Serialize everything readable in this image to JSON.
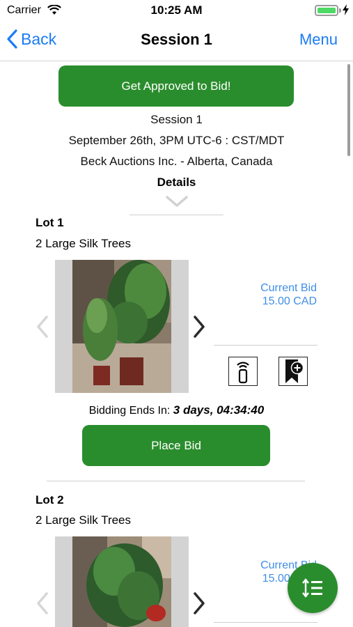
{
  "status_bar": {
    "carrier": "Carrier",
    "time": "10:25 AM",
    "battery_color": "#4cd964"
  },
  "nav": {
    "back_label": "Back",
    "title": "Session 1",
    "menu_label": "Menu",
    "back_icon": "chevron-left-icon"
  },
  "session": {
    "approve_label": "Get Approved to Bid!",
    "name": "Session 1",
    "date": "September 26th, 3PM UTC-6 : CST/MDT",
    "auctioneer": "Beck Auctions Inc. - Alberta, Canada",
    "details_label": "Details"
  },
  "lots": [
    {
      "title": "Lot 1",
      "description": "2 Large Silk Trees",
      "current_bid_label": "Current Bid",
      "current_bid_value": "15.00 CAD",
      "bidding_ends_label": "Bidding Ends In:",
      "bidding_ends_time": "3 days, 04:34:40",
      "place_bid_label": "Place Bid"
    },
    {
      "title": "Lot 2",
      "description": "2 Large Silk Trees",
      "current_bid_label": "Current Bid",
      "current_bid_value": "15.00 CAD"
    }
  ],
  "colors": {
    "accent_green": "#2a8d2d",
    "link_blue": "#1a7cf3",
    "bid_blue": "#3f8ee5"
  },
  "fab_icon": "sort-icon"
}
